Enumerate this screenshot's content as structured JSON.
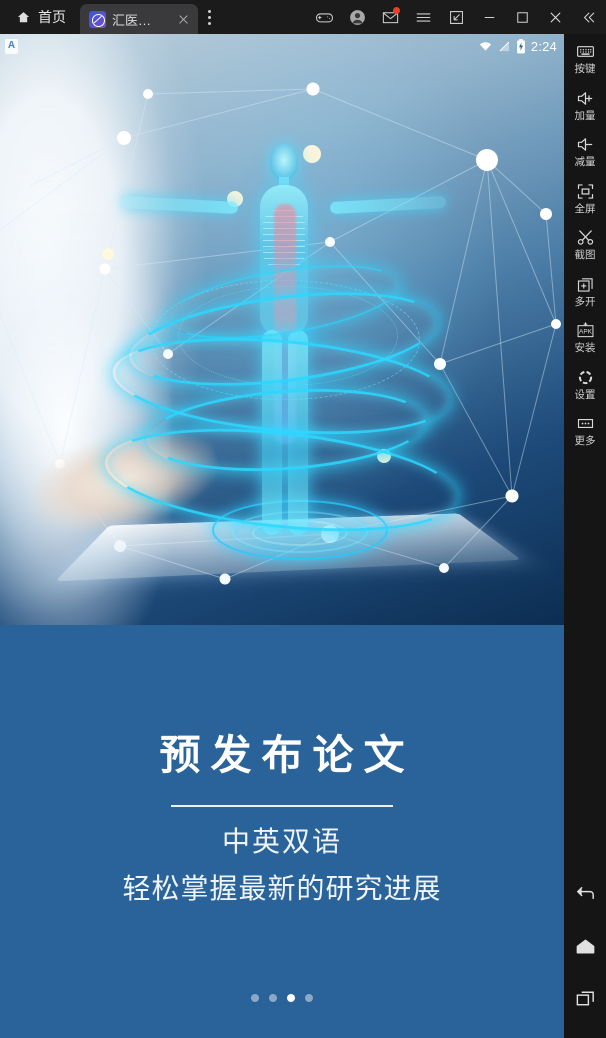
{
  "titlebar": {
    "home_label": "首页",
    "tab": {
      "label": "汇医…",
      "favicon_name": "huiyi-logo-icon",
      "close_name": "tab-close-icon"
    },
    "tab_menu_name": "tab-overflow-menu",
    "buttons": [
      {
        "name": "gamepad-icon",
        "label": ""
      },
      {
        "name": "account-avatar-icon",
        "label": ""
      },
      {
        "name": "mail-icon",
        "label": "",
        "badge": true
      },
      {
        "name": "hamburger-menu-icon",
        "label": ""
      },
      {
        "name": "resize-icon",
        "label": ""
      },
      {
        "name": "minimize-icon",
        "label": ""
      },
      {
        "name": "maximize-icon",
        "label": ""
      },
      {
        "name": "close-icon",
        "label": ""
      },
      {
        "name": "collapse-sidebar-icon",
        "label": ""
      }
    ]
  },
  "statusbar": {
    "app_badge": "A",
    "wifi_icon": "wifi-icon",
    "signal_icon": "signal-off-icon",
    "battery_icon": "battery-charging-icon",
    "time": "2:24"
  },
  "app": {
    "hero_alt": "holographic-human-body-medical-illustration",
    "title": "预发布论文",
    "subtitle_1": "中英双语",
    "subtitle_2": "轻松掌握最新的研究进展",
    "pager": {
      "count": 4,
      "active_index": 2
    },
    "colors": {
      "panel_blue": "#2a639a",
      "title_white": "#ffffff",
      "holo_cyan": "#2dd7ff"
    }
  },
  "sidebar": {
    "items": [
      {
        "label": "按键",
        "icon": "keyboard-icon"
      },
      {
        "label": "加量",
        "icon": "volume-up-icon"
      },
      {
        "label": "减量",
        "icon": "volume-down-icon"
      },
      {
        "label": "全屏",
        "icon": "fullscreen-icon"
      },
      {
        "label": "截图",
        "icon": "scissors-screenshot-icon"
      },
      {
        "label": "多开",
        "icon": "multi-instance-icon"
      },
      {
        "label": "安装",
        "icon": "apk-install-icon"
      },
      {
        "label": "设置",
        "icon": "gear-settings-icon"
      },
      {
        "label": "更多",
        "icon": "more-dots-icon"
      }
    ],
    "nav": [
      {
        "name": "android-back-icon"
      },
      {
        "name": "android-home-icon"
      },
      {
        "name": "android-recents-icon"
      }
    ]
  }
}
